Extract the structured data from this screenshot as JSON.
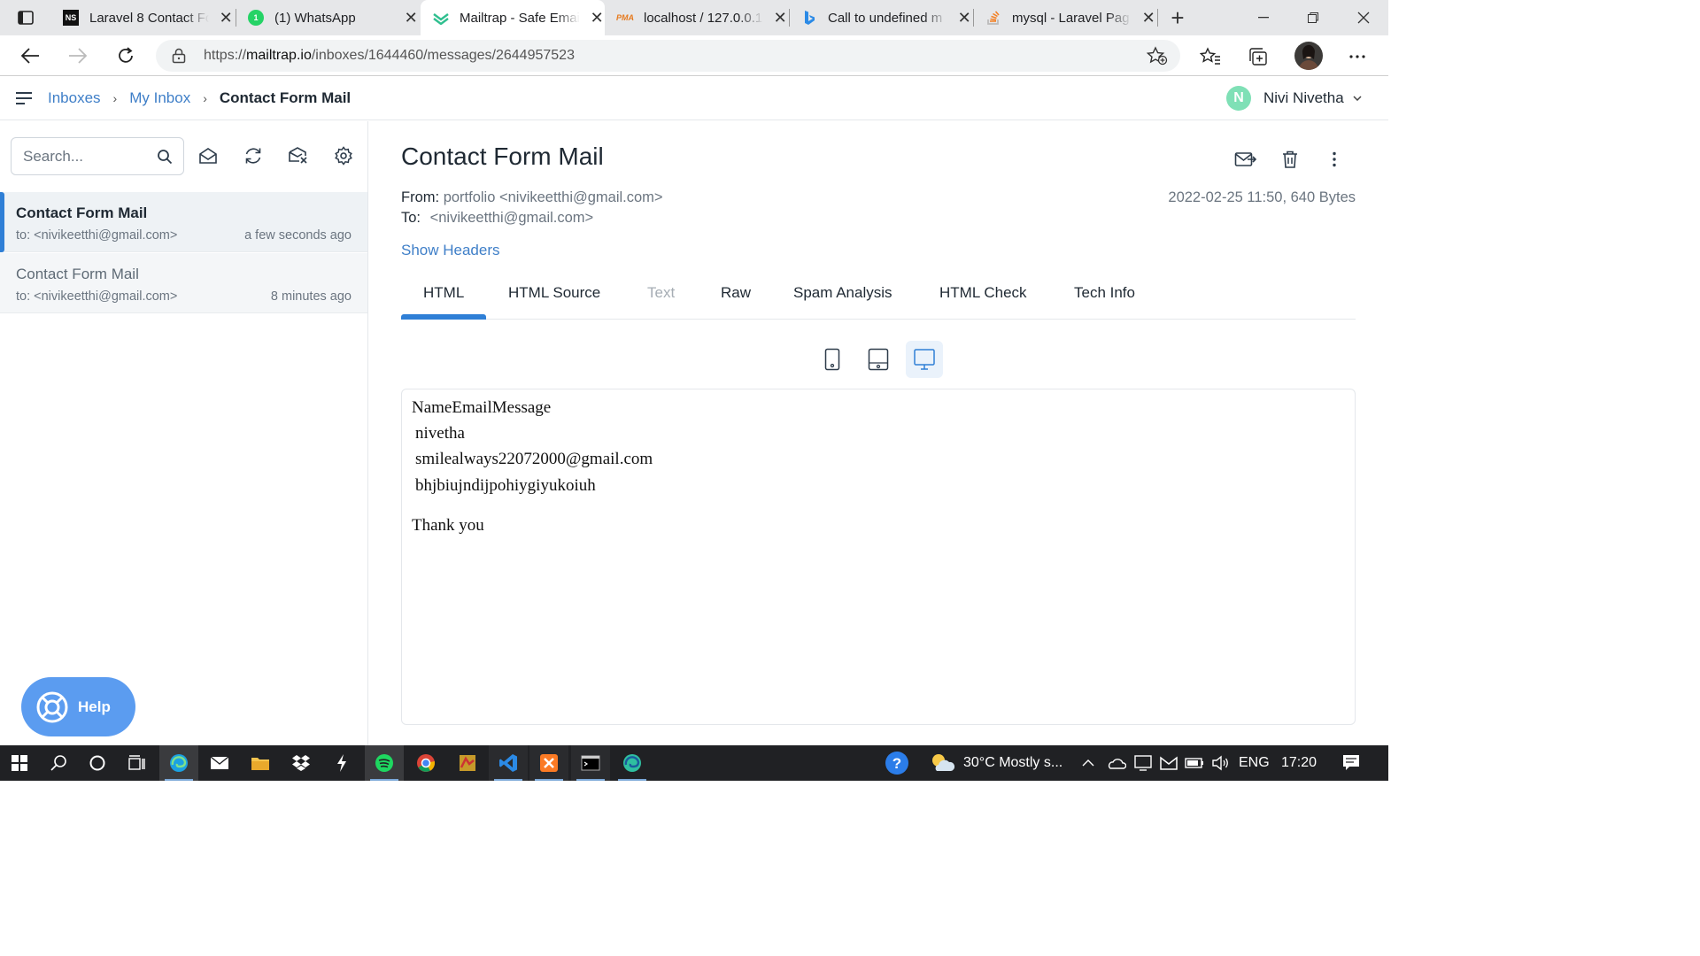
{
  "browser": {
    "tabs": [
      {
        "label": "Laravel 8 Contact Form",
        "favicon": "NS"
      },
      {
        "label": "(1) WhatsApp",
        "favicon": "1"
      },
      {
        "label": "Mailtrap - Safe Email",
        "favicon": "mailtrap"
      },
      {
        "label": "localhost / 127.0.0.1",
        "favicon": "PMA"
      },
      {
        "label": "Call to undefined m",
        "favicon": "bing"
      },
      {
        "label": "mysql - Laravel Pag",
        "favicon": "stackoverflow"
      }
    ],
    "active_tab": 2,
    "url_prefix": "https://",
    "url_domain": "mailtrap.io",
    "url_path": "/inboxes/1644460/messages/2644957523"
  },
  "app": {
    "breadcrumb": {
      "inboxes": "Inboxes",
      "my_inbox": "My Inbox",
      "current": "Contact Form Mail"
    },
    "user": {
      "initial": "N",
      "name": "Nivi Nivetha"
    }
  },
  "sidebar": {
    "search_placeholder": "Search...",
    "messages": [
      {
        "subject": "Contact Form Mail",
        "to": "to: <nivikeetthi@gmail.com>",
        "time": "a few seconds ago",
        "selected": true
      },
      {
        "subject": "Contact Form Mail",
        "to": "to: <nivikeetthi@gmail.com>",
        "time": "8 minutes ago",
        "selected": false
      }
    ],
    "help_label": "Help"
  },
  "message": {
    "title": "Contact Form Mail",
    "from_label": "From:",
    "from_value": "portfolio <nivikeetthi@gmail.com>",
    "to_label": "To:",
    "to_value": "<nivikeetthi@gmail.com>",
    "meta": "2022-02-25 11:50, 640 Bytes",
    "show_headers": "Show Headers",
    "tabs": [
      "HTML",
      "HTML Source",
      "Text",
      "Raw",
      "Spam Analysis",
      "HTML Check",
      "Tech Info"
    ],
    "active_tab": "HTML",
    "disabled_tab": "Text",
    "body_lines": [
      "NameEmailMessage",
      "nivetha",
      "smilealways22072000@gmail.com",
      "bhjbiujndijpohiygiyukoiuh",
      "Thank you"
    ]
  },
  "taskbar": {
    "weather": "30°C  Mostly s...",
    "lang": "ENG",
    "clock": "17:20"
  },
  "colors": {
    "accent": "#2f7fd6",
    "link": "#3f7fc8",
    "help": "#5b9cf0",
    "avatar": "#7fe0b6"
  }
}
